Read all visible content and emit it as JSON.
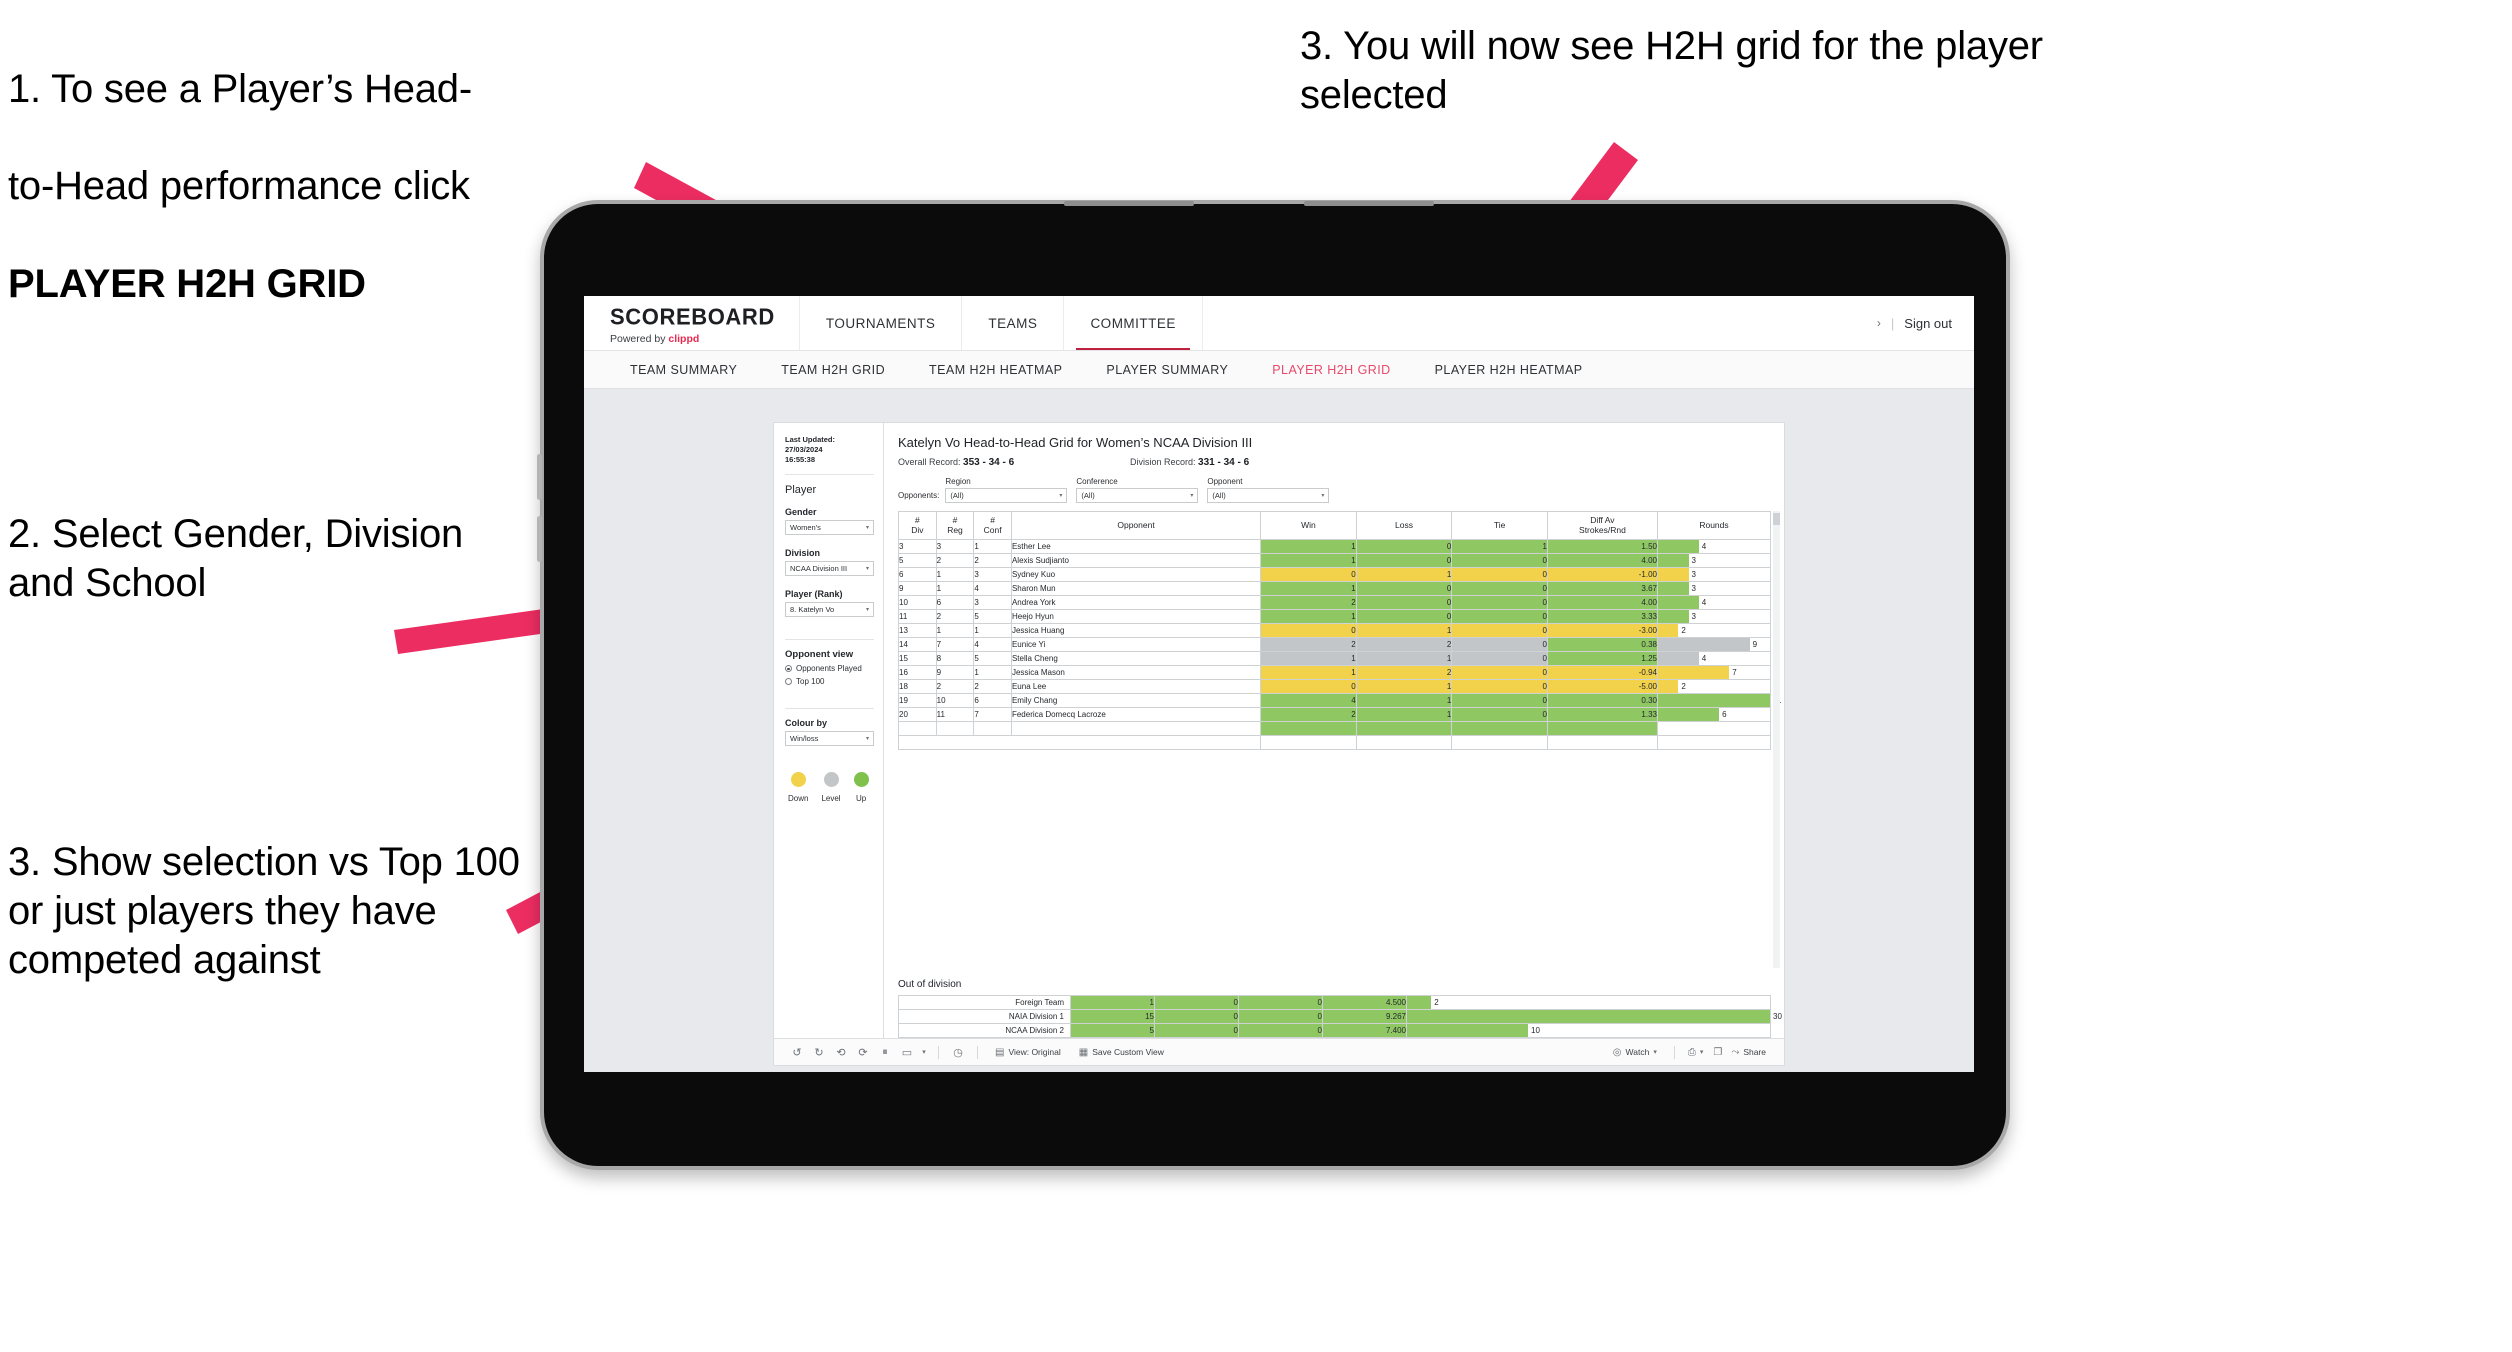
{
  "annotations": {
    "step1_line1": "1. To see a Player’s Head-",
    "step1_line2": "to-Head performance click",
    "step1_bold": "PLAYER H2H GRID",
    "step2": "2. Select Gender, Division and School",
    "step3_left": "3. Show selection vs Top 100 or just players they have competed against",
    "step3_right": "3. You will now see H2H grid for the player selected"
  },
  "colors": {
    "accent_pink": "#ec2d62",
    "nav_active": "#e8496b",
    "green": "#8fc763",
    "yellow": "#f2d24b",
    "grey": "#c3c6c8",
    "brand_red": "#e8294e"
  },
  "app": {
    "brand": {
      "title": "SCOREBOARD",
      "powered_prefix": "Powered by",
      "powered_brand": "clippd"
    },
    "topnav": [
      {
        "label": "TOURNAMENTS",
        "active": false
      },
      {
        "label": "TEAMS",
        "active": false
      },
      {
        "label": "COMMITTEE",
        "active": true
      }
    ],
    "topbar_right": {
      "chevron": "›",
      "separator": "|",
      "sign_out": "Sign out"
    },
    "subnav": [
      {
        "label": "TEAM SUMMARY",
        "active": false
      },
      {
        "label": "TEAM H2H GRID",
        "active": false
      },
      {
        "label": "TEAM H2H HEATMAP",
        "active": false
      },
      {
        "label": "PLAYER SUMMARY",
        "active": false
      },
      {
        "label": "PLAYER H2H GRID",
        "active": true
      },
      {
        "label": "PLAYER H2H HEATMAP",
        "active": false
      }
    ]
  },
  "rail": {
    "last_updated_line1": "Last Updated: 27/03/2024",
    "last_updated_line2": "16:55:38",
    "player_heading": "Player",
    "filters": [
      {
        "label": "Gender",
        "value": "Women's"
      },
      {
        "label": "Division",
        "value": "NCAA Division III"
      },
      {
        "label": "Player (Rank)",
        "value": "8. Katelyn Vo"
      }
    ],
    "opponent_view": {
      "heading": "Opponent view",
      "options": [
        {
          "label": "Opponents Played",
          "selected": true
        },
        {
          "label": "Top 100",
          "selected": false
        }
      ]
    },
    "colour_by": {
      "label": "Colour by",
      "value": "Win/loss"
    },
    "legend": [
      {
        "label": "Down",
        "color": "#f2d24b"
      },
      {
        "label": "Level",
        "color": "#c3c6c8"
      },
      {
        "label": "Up",
        "color": "#8fc763"
      }
    ]
  },
  "viz": {
    "title": "Katelyn Vo Head-to-Head Grid for Women’s NCAA Division III",
    "overall_record_label": "Overall Record:",
    "overall_record_value": "353 -  34 - 6",
    "division_record_label": "Division Record:",
    "division_record_value": "331 -  34 - 6",
    "opponents_label": "Opponents:",
    "opponent_filters": [
      {
        "label": "Region",
        "value": "(All)"
      },
      {
        "label": "Conference",
        "value": "(All)"
      },
      {
        "label": "Opponent",
        "value": "(All)"
      }
    ]
  },
  "chart_data": {
    "type": "table",
    "title": "Katelyn Vo Head-to-Head Grid for Women’s NCAA Division III",
    "columns": [
      "# Div",
      "# Reg",
      "# Conf",
      "Opponent",
      "Win",
      "Loss",
      "Tie",
      "Diff Av Strokes/Rnd",
      "Rounds"
    ],
    "column_headers_multiline": [
      [
        "#",
        "Div"
      ],
      [
        "#",
        "Reg"
      ],
      [
        "#",
        "Conf"
      ],
      [
        "Opponent"
      ],
      [
        "Win"
      ],
      [
        "Loss"
      ],
      [
        "Tie"
      ],
      [
        "Diff Av",
        "Strokes/Rnd"
      ],
      [
        "Rounds"
      ]
    ],
    "rounds_max": 11,
    "rows": [
      {
        "div": "3",
        "reg": "3",
        "conf": "1",
        "opponent": "Esther Lee",
        "win": "1",
        "loss": "0",
        "tie": "1",
        "diff": "1.50",
        "rounds": 4,
        "status": "up"
      },
      {
        "div": "5",
        "reg": "2",
        "conf": "2",
        "opponent": "Alexis Sudjianto",
        "win": "1",
        "loss": "0",
        "tie": "0",
        "diff": "4.00",
        "rounds": 3,
        "status": "up"
      },
      {
        "div": "6",
        "reg": "1",
        "conf": "3",
        "opponent": "Sydney Kuo",
        "win": "0",
        "loss": "1",
        "tie": "0",
        "diff": "-1.00",
        "rounds": 3,
        "status": "down"
      },
      {
        "div": "9",
        "reg": "1",
        "conf": "4",
        "opponent": "Sharon Mun",
        "win": "1",
        "loss": "0",
        "tie": "0",
        "diff": "3.67",
        "rounds": 3,
        "status": "up"
      },
      {
        "div": "10",
        "reg": "6",
        "conf": "3",
        "opponent": "Andrea York",
        "win": "2",
        "loss": "0",
        "tie": "0",
        "diff": "4.00",
        "rounds": 4,
        "status": "up"
      },
      {
        "div": "11",
        "reg": "2",
        "conf": "5",
        "opponent": "Heejo Hyun",
        "win": "1",
        "loss": "0",
        "tie": "0",
        "diff": "3.33",
        "rounds": 3,
        "status": "up"
      },
      {
        "div": "13",
        "reg": "1",
        "conf": "1",
        "opponent": "Jessica Huang",
        "win": "0",
        "loss": "1",
        "tie": "0",
        "diff": "-3.00",
        "rounds": 2,
        "status": "down"
      },
      {
        "div": "14",
        "reg": "7",
        "conf": "4",
        "opponent": "Eunice Yi",
        "win": "2",
        "loss": "2",
        "tie": "0",
        "diff": "0.38",
        "rounds": 9,
        "status": "level",
        "diff_status": "up"
      },
      {
        "div": "15",
        "reg": "8",
        "conf": "5",
        "opponent": "Stella Cheng",
        "win": "1",
        "loss": "1",
        "tie": "0",
        "diff": "1.25",
        "rounds": 4,
        "status": "level",
        "diff_status": "up"
      },
      {
        "div": "16",
        "reg": "9",
        "conf": "1",
        "opponent": "Jessica Mason",
        "win": "1",
        "loss": "2",
        "tie": "0",
        "diff": "-0.94",
        "rounds": 7,
        "status": "down"
      },
      {
        "div": "18",
        "reg": "2",
        "conf": "2",
        "opponent": "Euna Lee",
        "win": "0",
        "loss": "1",
        "tie": "0",
        "diff": "-5.00",
        "rounds": 2,
        "status": "down"
      },
      {
        "div": "19",
        "reg": "10",
        "conf": "6",
        "opponent": "Emily Chang",
        "win": "4",
        "loss": "1",
        "tie": "0",
        "diff": "0.30",
        "rounds": 11,
        "status": "up"
      },
      {
        "div": "20",
        "reg": "11",
        "conf": "7",
        "opponent": "Federica Domecq Lacroze",
        "win": "2",
        "loss": "1",
        "tie": "0",
        "diff": "1.33",
        "rounds": 6,
        "status": "up"
      }
    ],
    "out_of_division": {
      "title": "Out of division",
      "rounds_max": 30,
      "rows": [
        {
          "name": "Foreign Team",
          "win": "1",
          "loss": "0",
          "tie": "0",
          "diff": "4.500",
          "rounds": 2,
          "status": "up"
        },
        {
          "name": "NAIA Division 1",
          "win": "15",
          "loss": "0",
          "tie": "0",
          "diff": "9.267",
          "rounds": 30,
          "status": "up"
        },
        {
          "name": "NCAA Division 2",
          "win": "5",
          "loss": "0",
          "tie": "0",
          "diff": "7.400",
          "rounds": 10,
          "status": "up"
        }
      ]
    }
  },
  "toolbar": {
    "icons": [
      "undo-icon",
      "redo-icon",
      "revert-icon",
      "refresh-icon",
      "pause-icon",
      "share-view-icon",
      "caret-down-icon"
    ],
    "view_label": "View: Original",
    "save_view_label": "Save Custom View",
    "watch_label": "Watch",
    "share_label": "Share"
  }
}
